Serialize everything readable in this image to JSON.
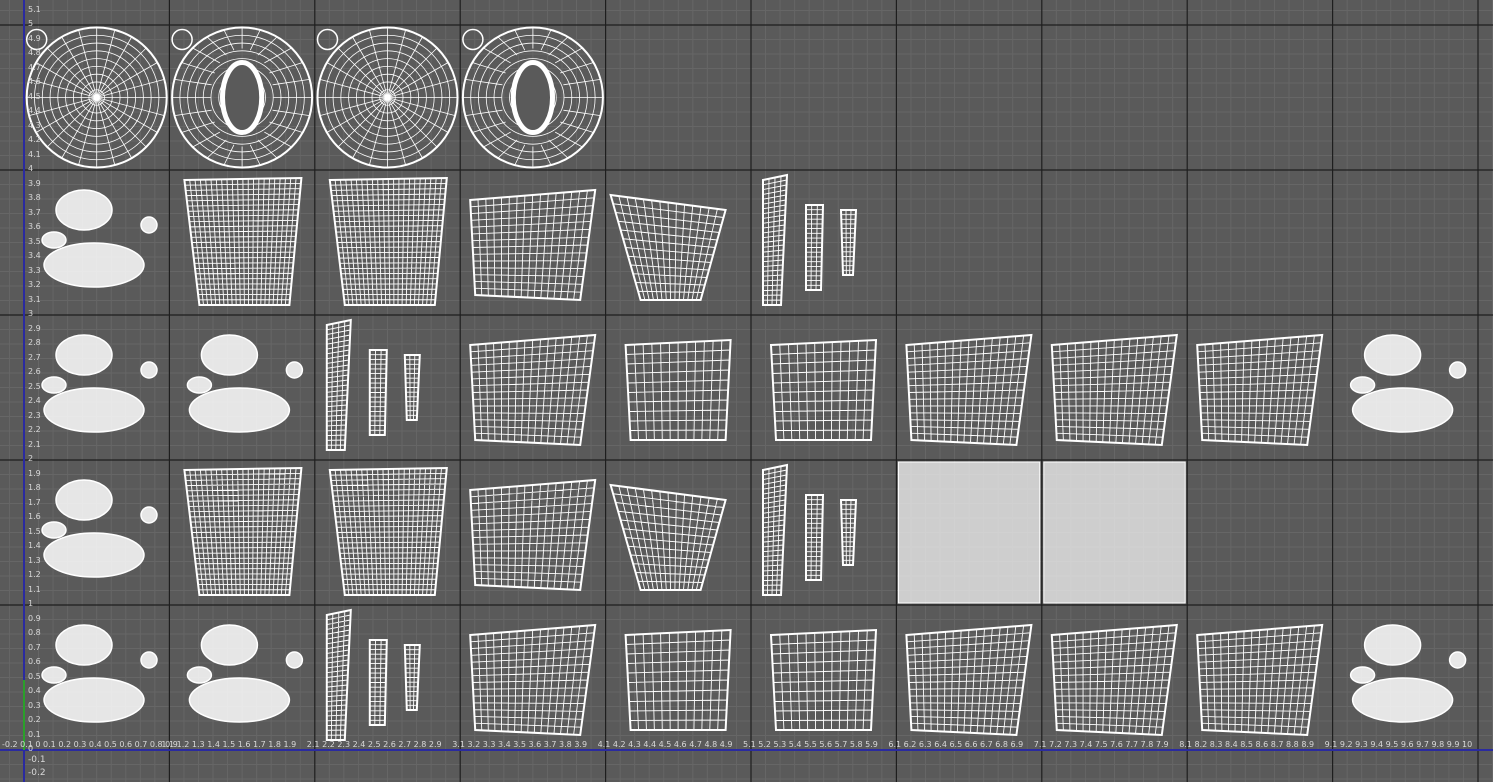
{
  "uv_view": {
    "tile_grid": {
      "columns": 10,
      "rows": 5
    },
    "u_range": [
      0,
      10
    ],
    "v_range": [
      -0.2,
      5.1
    ],
    "colors": {
      "background": "#5a5a5a",
      "minor_grid": "#666666",
      "major_grid": "#1e1e1e",
      "wireframe": "#ffffff",
      "u_axis": "#2a2aa0",
      "v_axis": "#2aa02a",
      "axis_labels": "#d8d8d8"
    },
    "v_axis_labels": [
      "5.1",
      "5",
      "4.9",
      "4.8",
      "4.7",
      "4.6",
      "4.5",
      "4.4",
      "4.3",
      "4.2",
      "4.1",
      "4",
      "3.9",
      "3.8",
      "3.7",
      "3.6",
      "3.5",
      "3.4",
      "3.3",
      "3.2",
      "3.1",
      "3",
      "2.9",
      "2.8",
      "2.7",
      "2.6",
      "2.5",
      "2.4",
      "2.3",
      "2.2",
      "2.1",
      "2",
      "1.9",
      "1.8",
      "1.7",
      "1.6",
      "1.5",
      "1.4",
      "1.3",
      "1.2",
      "1.1",
      "1",
      "0.9",
      "0.8",
      "0.7",
      "0.6",
      "0.5",
      "0.4",
      "0.3",
      "0.2",
      "0.1",
      "0"
    ],
    "negative_v_labels": [
      "-0.1",
      "-0.2"
    ],
    "u_axis_label_rows": [
      "-0.2 0.1 0 0.1 0.2 0.3 0.4 0.5 0.6 0.7 0.8 0.9",
      "1.1 1.2 1.3 1.4 1.5 1.6 1.7 1.8 1.9",
      "2.1 2.2 2.3 2.4 2.5 2.6 2.7 2.8 2.9",
      "3.1 3.2 3.3 3.4 3.5 3.6 3.7 3.8 3.9",
      "4.1 4.2 4.3 4.4 4.5 4.6 4.7 4.8 4.9",
      "5.1 5.2 5.3 5.4 5.5 5.6 5.7 5.8 5.9",
      "6.1 6.2 6.3 6.4 6.5 6.6 6.7 6.8 6.9",
      "7.1 7.2 7.3 7.4 7.5 7.6 7.7 7.8 7.9",
      "8.1 8.2 8.3 8.4 8.5 8.6 8.7 8.8 8.9",
      "9.1 9.2 9.3 9.4 9.5 9.6 9.7 9.8 9.9 10"
    ],
    "uv_shells": [
      {
        "tile": [
          0,
          4
        ],
        "type": "disk-full"
      },
      {
        "tile": [
          1,
          4
        ],
        "type": "disk-ring"
      },
      {
        "tile": [
          2,
          4
        ],
        "type": "disk-full"
      },
      {
        "tile": [
          3,
          4
        ],
        "type": "disk-ring"
      },
      {
        "tile": [
          0,
          3
        ],
        "type": "scatter"
      },
      {
        "tile": [
          1,
          3
        ],
        "type": "patch"
      },
      {
        "tile": [
          2,
          3
        ],
        "type": "patch"
      },
      {
        "tile": [
          3,
          3
        ],
        "type": "quad"
      },
      {
        "tile": [
          4,
          3
        ],
        "type": "trapezoid"
      },
      {
        "tile": [
          5,
          3
        ],
        "type": "strips"
      },
      {
        "tile": [
          0,
          2
        ],
        "type": "scatter"
      },
      {
        "tile": [
          1,
          2
        ],
        "type": "scatter"
      },
      {
        "tile": [
          2,
          2
        ],
        "type": "strips"
      },
      {
        "tile": [
          3,
          2
        ],
        "type": "quad"
      },
      {
        "tile": [
          4,
          2
        ],
        "type": "l-shape"
      },
      {
        "tile": [
          5,
          2
        ],
        "type": "l-shape"
      },
      {
        "tile": [
          6,
          2
        ],
        "type": "quad"
      },
      {
        "tile": [
          7,
          2
        ],
        "type": "quad"
      },
      {
        "tile": [
          8,
          2
        ],
        "type": "quad"
      },
      {
        "tile": [
          9,
          2
        ],
        "type": "scatter"
      },
      {
        "tile": [
          0,
          1
        ],
        "type": "scatter"
      },
      {
        "tile": [
          1,
          1
        ],
        "type": "patch"
      },
      {
        "tile": [
          2,
          1
        ],
        "type": "patch"
      },
      {
        "tile": [
          3,
          1
        ],
        "type": "quad"
      },
      {
        "tile": [
          4,
          1
        ],
        "type": "trapezoid"
      },
      {
        "tile": [
          5,
          1
        ],
        "type": "strips"
      },
      {
        "tile": [
          6,
          1
        ],
        "type": "dense"
      },
      {
        "tile": [
          7,
          1
        ],
        "type": "dense"
      },
      {
        "tile": [
          0,
          0
        ],
        "type": "scatter"
      },
      {
        "tile": [
          1,
          0
        ],
        "type": "scatter"
      },
      {
        "tile": [
          2,
          0
        ],
        "type": "strips"
      },
      {
        "tile": [
          3,
          0
        ],
        "type": "quad"
      },
      {
        "tile": [
          4,
          0
        ],
        "type": "l-shape"
      },
      {
        "tile": [
          5,
          0
        ],
        "type": "l-shape"
      },
      {
        "tile": [
          6,
          0
        ],
        "type": "quad"
      },
      {
        "tile": [
          7,
          0
        ],
        "type": "quad"
      },
      {
        "tile": [
          8,
          0
        ],
        "type": "quad"
      },
      {
        "tile": [
          9,
          0
        ],
        "type": "scatter"
      }
    ]
  }
}
